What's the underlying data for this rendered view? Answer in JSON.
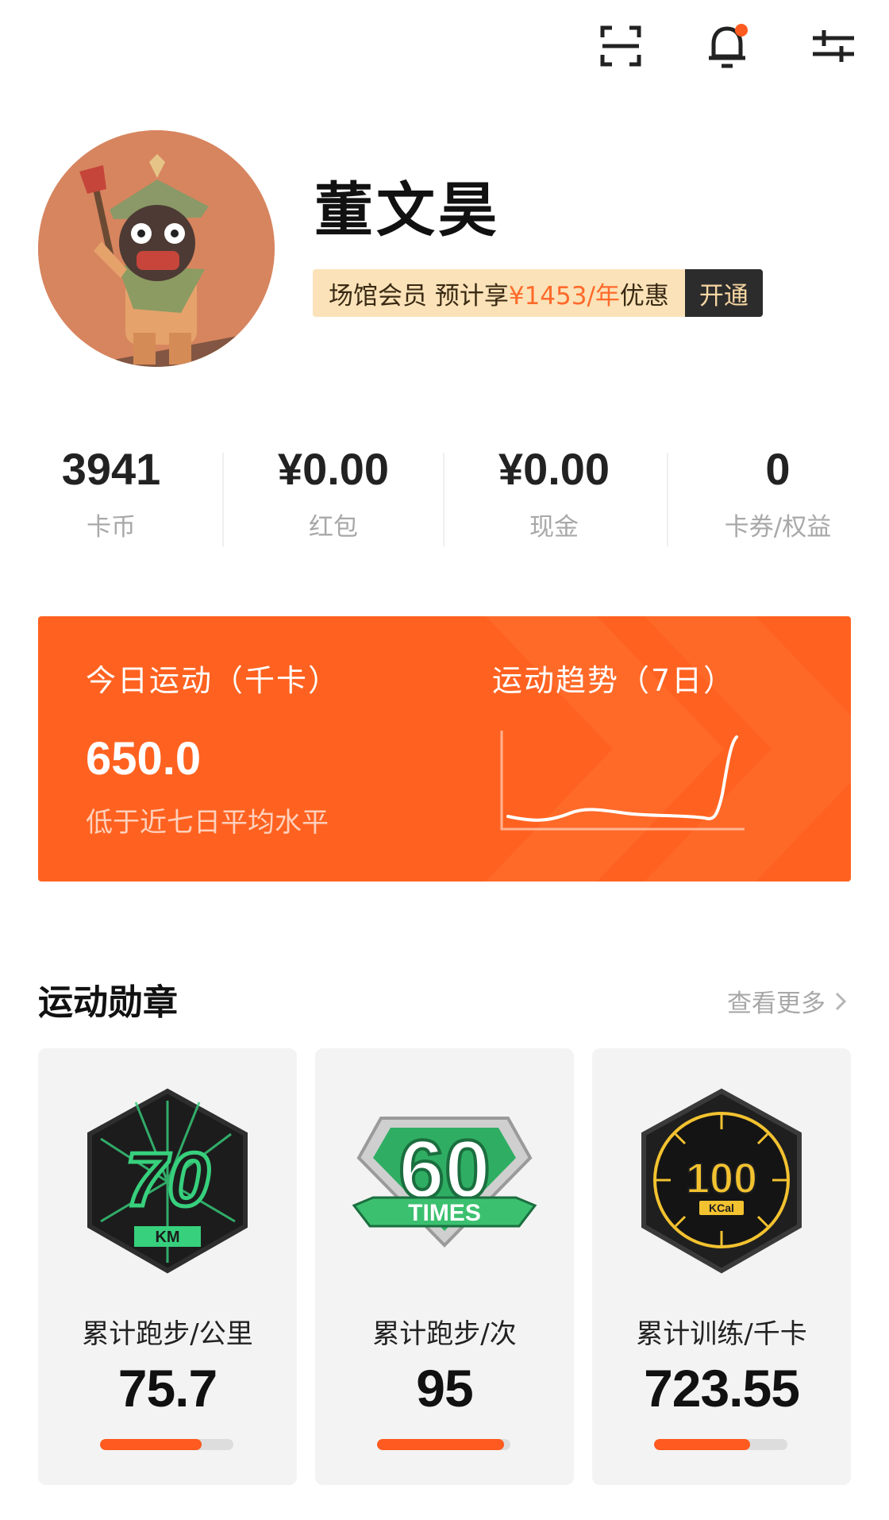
{
  "header": {
    "icons": [
      "scan-icon",
      "bell-icon",
      "settings-sliders-icon"
    ],
    "has_notification": true
  },
  "profile": {
    "name": "董文昊",
    "membership": {
      "text_prefix": "场馆会员 预计享",
      "price": "¥1453/年",
      "text_suffix": "优惠",
      "button": "开通"
    }
  },
  "stats": [
    {
      "value": "3941",
      "label": "卡币"
    },
    {
      "value": "¥0.00",
      "label": "红包"
    },
    {
      "value": "¥0.00",
      "label": "现金"
    },
    {
      "value": "0",
      "label": "卡券/权益"
    }
  ],
  "activity": {
    "today_title": "今日运动（千卡）",
    "today_value": "650.0",
    "today_note": "低于近七日平均水平",
    "trend_title": "运动趋势（7日）"
  },
  "medals": {
    "title": "运动勋章",
    "see_more": "查看更多",
    "items": [
      {
        "label": "累计跑步/公里",
        "value": "75.7",
        "progress": 0.76,
        "badge_text": "70",
        "badge_unit": "KM"
      },
      {
        "label": "累计跑步/次",
        "value": "95",
        "progress": 0.95,
        "badge_text": "60",
        "badge_unit": "TIMES"
      },
      {
        "label": "累计训练/千卡",
        "value": "723.55",
        "progress": 0.72,
        "badge_text": "100",
        "badge_unit": "KCal"
      }
    ]
  },
  "colors": {
    "accent": "#ff6220",
    "member_bg": "#fbe2b8"
  }
}
